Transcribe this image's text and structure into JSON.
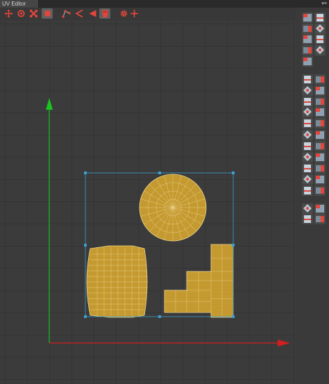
{
  "window": {
    "tab_title": "UV Editor",
    "tab_menu_icon": "menu-dropdown-icon"
  },
  "toolbar": {
    "tools": [
      {
        "name": "move-tool-icon",
        "active": false
      },
      {
        "name": "rotate-tool-icon",
        "active": false
      },
      {
        "name": "scale-tool-icon",
        "active": false
      },
      {
        "name": "rect-select-tool-icon",
        "active": true
      },
      {
        "name": "vertex-mode-icon",
        "active": false
      },
      {
        "name": "edge-mode-icon",
        "active": false
      },
      {
        "name": "face-mode-icon",
        "active": false
      },
      {
        "name": "element-mode-icon",
        "active": true
      },
      {
        "name": "settings-gear-icon",
        "active": false
      },
      {
        "name": "pivot-icon",
        "active": false
      }
    ]
  },
  "colors": {
    "background": "#3b3b3b",
    "grid": "#343434",
    "u_axis": "#d11f1f",
    "v_axis": "#18c41f",
    "uv_face": "#c8a032",
    "uv_edge": "#f0d890",
    "selection": "#3aa0d0",
    "accent": "#e2463c"
  },
  "side_panel": {
    "buttons": [
      "unfold-icon",
      "relax-icon",
      "pack-icon",
      "align-icon",
      "stitch-icon",
      "weld-icon",
      "split-icon",
      "flip-icon",
      "straighten-icon",
      "sew-icon",
      "layout-icon",
      "orient-icon",
      "align-left-icon",
      "align-right-icon",
      "align-top-icon",
      "align-bottom-icon",
      "distribute-h-icon",
      "distribute-v-icon",
      "snap-left-icon",
      "snap-right-icon",
      "stack-top-icon",
      "stack-bottom-icon",
      "stretch-h-icon",
      "stretch-v-icon",
      "match-left-icon",
      "match-right-icon",
      "match-top-icon",
      "match-bottom-icon",
      "gather-icon",
      "scatter-icon",
      "shell-select-icon",
      "grow-select-icon",
      "checker-icon",
      "grid-snap-icon",
      "cut-icon"
    ]
  }
}
